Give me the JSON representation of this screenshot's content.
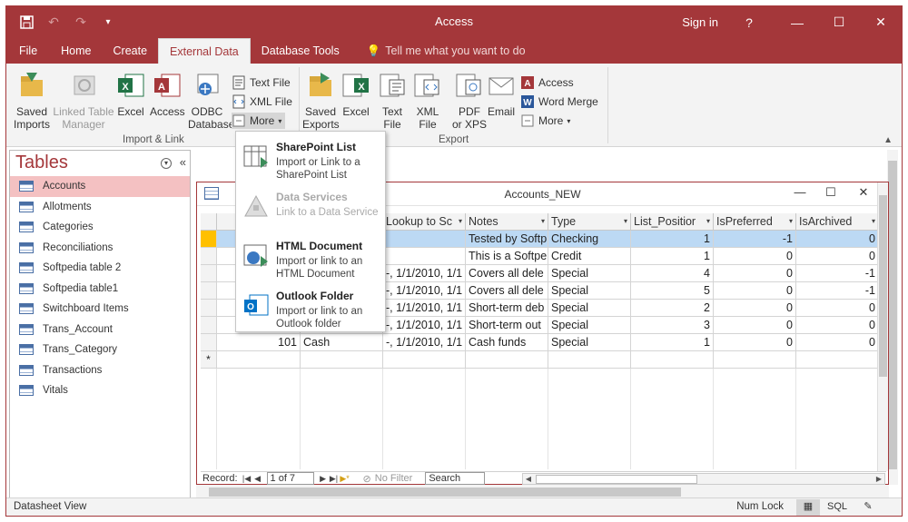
{
  "window": {
    "title": "Access",
    "sign_in": "Sign in",
    "help": "?"
  },
  "tabs": [
    "File",
    "Home",
    "Create",
    "External Data",
    "Database Tools"
  ],
  "tell_me": "Tell me what you want to do",
  "ribbon": {
    "import_group": {
      "label": "Import & Link",
      "saved_imports": [
        "Saved",
        "Imports"
      ],
      "linked_table_manager": [
        "Linked Table",
        "Manager"
      ],
      "excel": "Excel",
      "access": "Access",
      "odbc": [
        "ODBC",
        "Database"
      ],
      "text_file": "Text File",
      "xml_file": "XML File",
      "more": "More"
    },
    "export_group": {
      "label": "Export",
      "saved_exports": [
        "Saved",
        "Exports"
      ],
      "excel": "Excel",
      "text_file": [
        "Text",
        "File"
      ],
      "xml_file": [
        "XML",
        "File"
      ],
      "pdf": [
        "PDF",
        "or XPS"
      ],
      "email": "Email",
      "access": "Access",
      "word_merge": "Word Merge",
      "more": "More"
    }
  },
  "more_menu": [
    {
      "title": "SharePoint List",
      "desc": "Import or Link to a SharePoint List",
      "enabled": true
    },
    {
      "title": "Data Services",
      "desc": "Link to a Data Service",
      "enabled": false
    },
    {
      "title": "HTML Document",
      "desc": "Import or link to an HTML Document",
      "enabled": true
    },
    {
      "title": "Outlook Folder",
      "desc": "Import or link to an Outlook folder",
      "enabled": true
    }
  ],
  "nav": {
    "title": "Tables",
    "items": [
      "Accounts",
      "Allotments",
      "Categories",
      "Reconciliations",
      "Softpedia table 2",
      "Softpedia table1",
      "Switchboard Items",
      "Trans_Account",
      "Trans_Category",
      "Transactions",
      "Vitals"
    ]
  },
  "datasheet": {
    "title": "Accounts_NEW",
    "columns": [
      "",
      "",
      "Lookup to Sc",
      "Notes",
      "Type",
      "List_Positior",
      "IsPreferred",
      "IsArchived"
    ],
    "rows": [
      [
        "",
        "",
        "",
        "Tested by Softp",
        "Checking",
        "1",
        "-1",
        "0"
      ],
      [
        "",
        "",
        "",
        "This is a Softpe",
        "Credit",
        "1",
        "0",
        "0"
      ],
      [
        "",
        "",
        "-, 1/1/2010, 1/1",
        "Covers all dele",
        "Special",
        "4",
        "0",
        "-1"
      ],
      [
        "",
        "",
        "-, 1/1/2010, 1/1",
        "Covers all dele",
        "Special",
        "5",
        "0",
        "-1"
      ],
      [
        "",
        "",
        "-, 1/1/2010, 1/1",
        "Short-term deb",
        "Special",
        "2",
        "0",
        "0"
      ],
      [
        "",
        "",
        "-, 1/1/2010, 1/1",
        "Short-term out",
        "Special",
        "3",
        "0",
        "0"
      ],
      [
        "101",
        "Cash",
        "-, 1/1/2010, 1/1",
        "Cash funds",
        "Special",
        "1",
        "0",
        "0"
      ]
    ],
    "new_row_marker": "*",
    "record_nav": {
      "label": "Record:",
      "position": "1 of 7",
      "no_filter": "No Filter",
      "search": "Search"
    }
  },
  "status": {
    "left": "Datasheet View",
    "num_lock": "Num Lock",
    "sql": "SQL"
  }
}
